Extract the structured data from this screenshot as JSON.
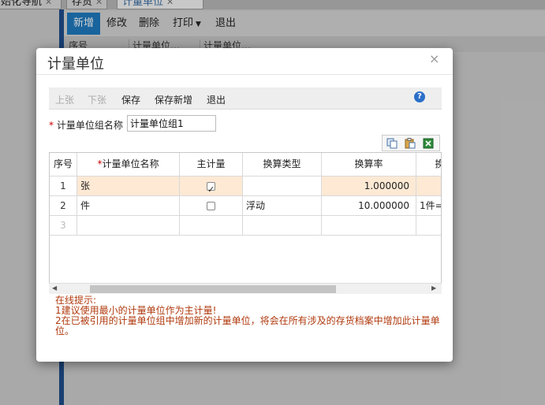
{
  "tabs": [
    {
      "label": "始化导航"
    },
    {
      "label": "存货"
    },
    {
      "label": "计量单位"
    }
  ],
  "toolbar": {
    "new": "新增",
    "edit": "修改",
    "delete": "删除",
    "print": "打印",
    "exit": "退出"
  },
  "bg_grid_headers": [
    "序号",
    "计量单位…",
    "计量单位…"
  ],
  "dialog": {
    "title": "计量单位",
    "close": "×",
    "toolbar": {
      "prev": "上张",
      "next": "下张",
      "save": "保存",
      "save_new": "保存新增",
      "exit": "退出"
    },
    "help": "?",
    "name_label": "计量单位组名称",
    "required_mark": "*",
    "name_value": "计量单位组1",
    "table": {
      "headers": [
        "序号",
        "计量单位名称",
        "主计量",
        "换算类型",
        "换算率",
        "换"
      ],
      "rows": [
        {
          "no": "1",
          "name": "张",
          "main": true,
          "type": "",
          "rate": "1.000000",
          "extra": ""
        },
        {
          "no": "2",
          "name": "件",
          "main": false,
          "type": "浮动",
          "rate": "10.000000",
          "extra": "1件=1"
        },
        {
          "no": "3",
          "name": "",
          "main": null,
          "type": "",
          "rate": "",
          "extra": ""
        }
      ]
    },
    "tips": {
      "title": "在线提示:",
      "line1": "1建议使用最小的计量单位作为主计量!",
      "line2": "2在已被引用的计量单位组中增加新的计量单位，将会在所有涉及的存货档案中增加此计量单位。"
    }
  },
  "colors": {
    "primary_button": "#1f7ac0",
    "highlight_row": "#fde9d4",
    "tips_text": "#b03a0e",
    "required": "#cc0000"
  }
}
